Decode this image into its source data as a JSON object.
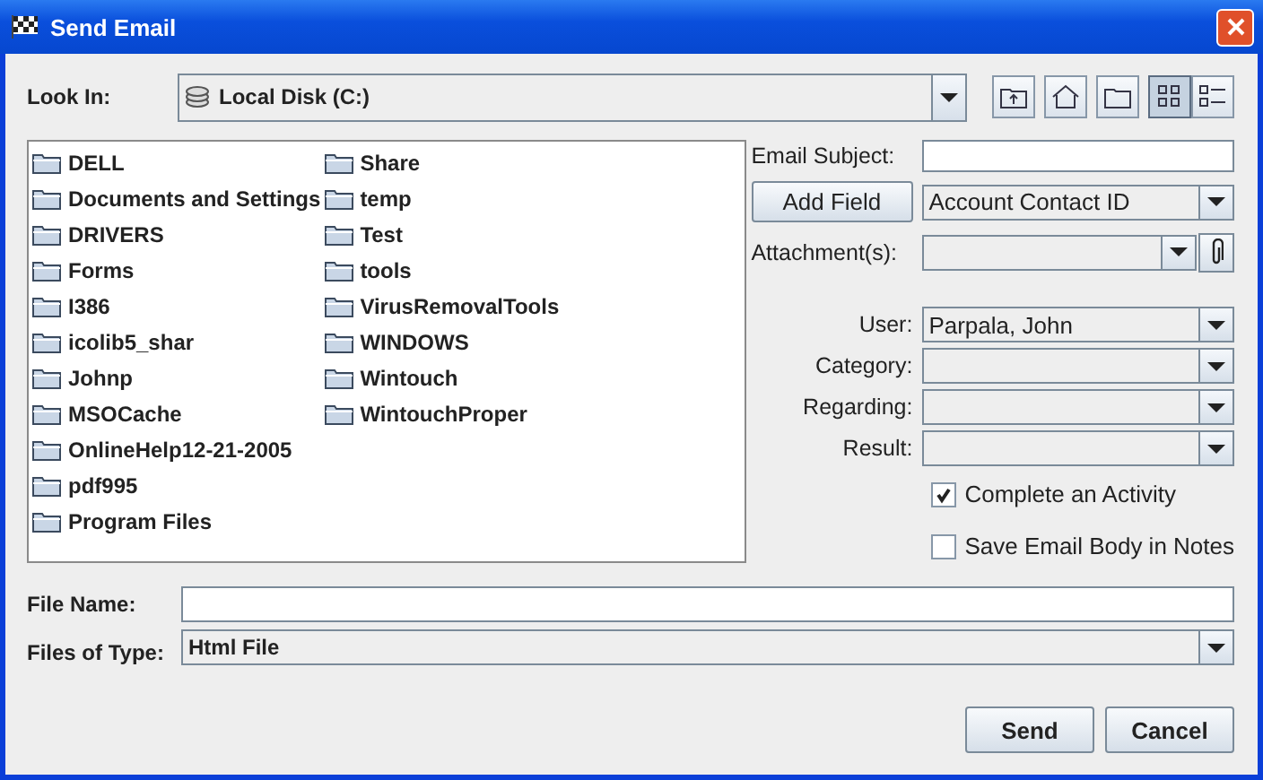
{
  "window": {
    "title": "Send Email"
  },
  "look_in": {
    "label": "Look In:",
    "value": "Local Disk (C:)"
  },
  "toolbar": [
    {
      "kind": "up",
      "selected": false
    },
    {
      "kind": "home",
      "selected": false
    },
    {
      "kind": "new_folder",
      "selected": false
    },
    {
      "kind": "list",
      "selected": true
    },
    {
      "kind": "details",
      "selected": false
    }
  ],
  "files": [
    "DELL",
    "Documents and Settings",
    "DRIVERS",
    "Forms",
    "I386",
    "icolib5_shar",
    "Johnp",
    "MSOCache",
    "OnlineHelp12-21-2005",
    "pdf995",
    "Program Files",
    "Share",
    "temp",
    "Test",
    "tools",
    "VirusRemovalTools",
    "WINDOWS",
    "Wintouch",
    "WintouchProper"
  ],
  "email_subject": {
    "label": "Email Subject:"
  },
  "add_field": {
    "button": "Add Field",
    "value": "Account Contact ID"
  },
  "attachments": {
    "label": "Attachment(s):"
  },
  "selects": [
    {
      "label": "User:",
      "value": "Parpala, John"
    },
    {
      "label": "Category:"
    },
    {
      "label": "Regarding:"
    },
    {
      "label": "Result:"
    }
  ],
  "checkboxes": [
    {
      "label": "Complete an Activity",
      "checked": true
    },
    {
      "label": "Save Email Body in Notes",
      "checked": false
    }
  ],
  "file_name": {
    "label": "File Name:"
  },
  "file_type": {
    "label": "Files of Type:",
    "value": "Html File"
  },
  "buttons": [
    "Send",
    "Cancel"
  ]
}
